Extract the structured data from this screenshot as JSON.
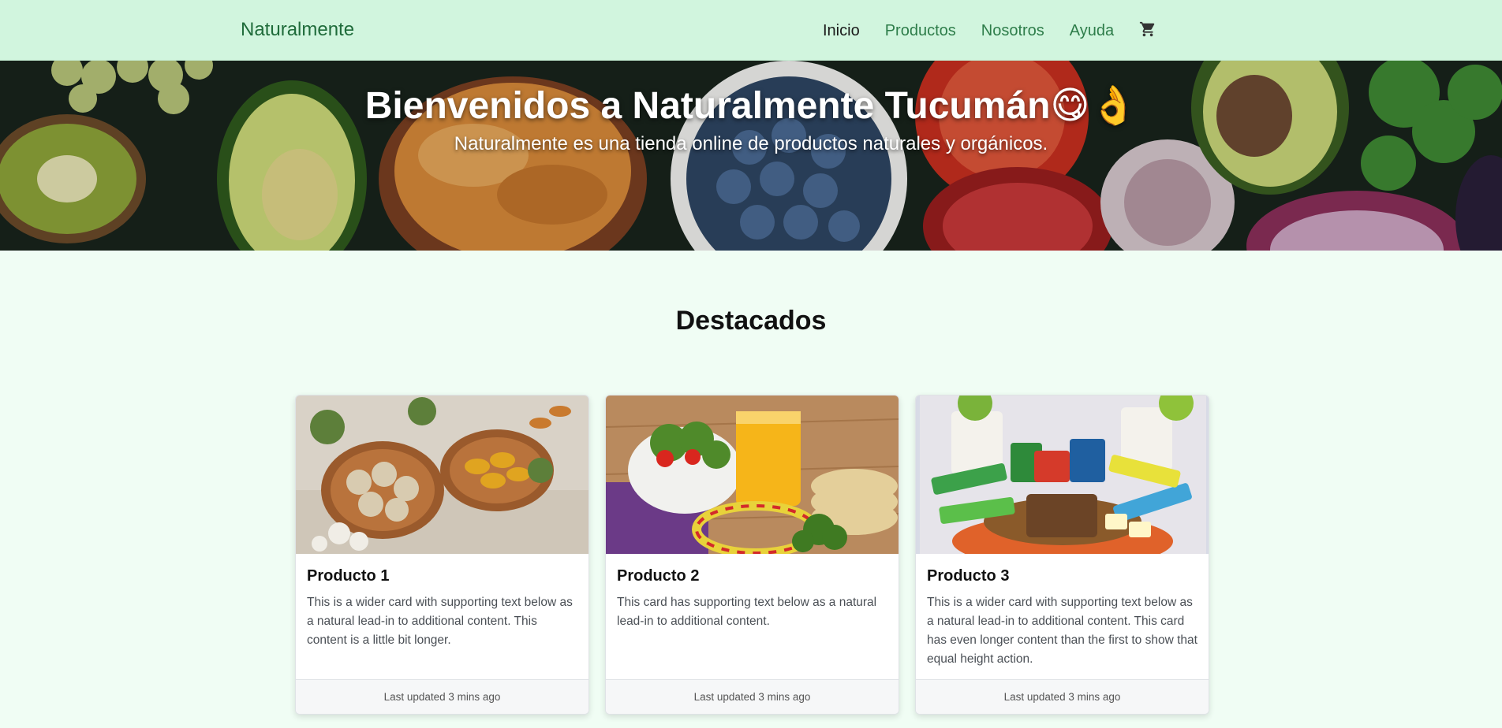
{
  "navbar": {
    "brand": "Naturalmente",
    "links": [
      {
        "label": "Inicio",
        "active": true
      },
      {
        "label": "Productos",
        "active": false
      },
      {
        "label": "Nosotros",
        "active": false
      },
      {
        "label": "Ayuda",
        "active": false
      }
    ],
    "cart_icon": "cart-icon"
  },
  "hero": {
    "title": "Bienvenidos a Naturalmente Tucumán😋👌",
    "subtitle": "Naturalmente es una tienda online de productos naturales y orgánicos."
  },
  "featured": {
    "heading": "Destacados",
    "cards": [
      {
        "title": "Producto 1",
        "text": "This is a wider card with supporting text below as a natural lead-in to additional content. This content is a little bit longer.",
        "footer": "Last updated 3 mins ago"
      },
      {
        "title": "Producto 2",
        "text": "This card has supporting text below as a natural lead-in to additional content.",
        "footer": "Last updated 3 mins ago"
      },
      {
        "title": "Producto 3",
        "text": "This is a wider card with supporting text below as a natural lead-in to additional content. This card has even longer content than the first to show that equal height action.",
        "footer": "Last updated 3 mins ago"
      }
    ]
  },
  "colors": {
    "navbar_bg": "#d1f5de",
    "page_bg": "#f0fdf4",
    "link": "#2e7d4a"
  }
}
